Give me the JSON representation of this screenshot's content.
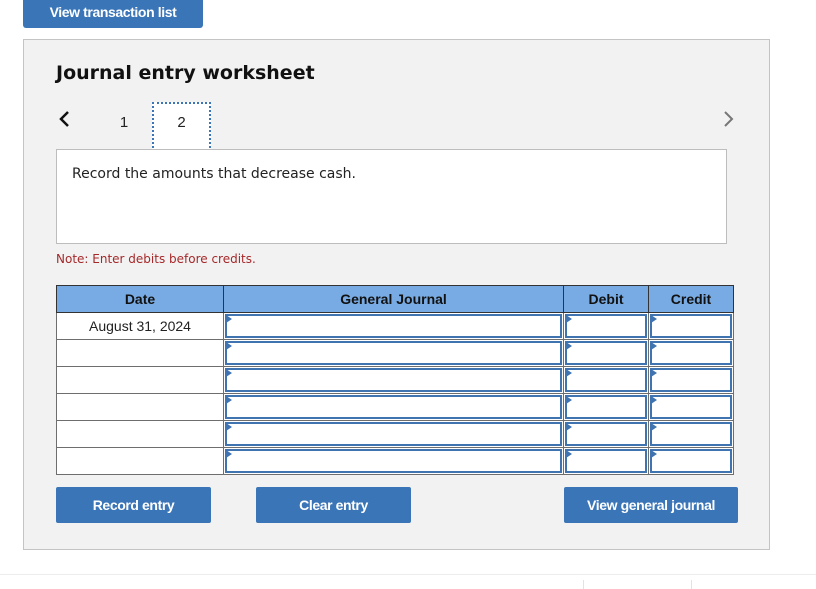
{
  "header": {
    "view_transactions_label": "View transaction list"
  },
  "worksheet": {
    "title": "Journal entry worksheet",
    "pages": [
      {
        "label": "1",
        "active": false
      },
      {
        "label": "2",
        "active": true
      }
    ],
    "prev_icon": "chevron-left-icon",
    "next_icon": "chevron-right-icon",
    "instruction": "Record the amounts that decrease cash.",
    "note": "Note: Enter debits before credits.",
    "colors": {
      "accent": "#3a75b8",
      "table_header": "#78abe3",
      "note_text": "#a5282a",
      "panel_bg": "#f2f2f2"
    }
  },
  "table": {
    "headers": {
      "date": "Date",
      "general_journal": "General Journal",
      "debit": "Debit",
      "credit": "Credit"
    },
    "rows": [
      {
        "date": "August 31, 2024",
        "account": "",
        "debit": "",
        "credit": ""
      },
      {
        "date": "",
        "account": "",
        "debit": "",
        "credit": ""
      },
      {
        "date": "",
        "account": "",
        "debit": "",
        "credit": ""
      },
      {
        "date": "",
        "account": "",
        "debit": "",
        "credit": ""
      },
      {
        "date": "",
        "account": "",
        "debit": "",
        "credit": ""
      },
      {
        "date": "",
        "account": "",
        "debit": "",
        "credit": ""
      }
    ]
  },
  "actions": {
    "record_entry": "Record entry",
    "clear_entry": "Clear entry",
    "view_general_journal": "View general journal"
  }
}
